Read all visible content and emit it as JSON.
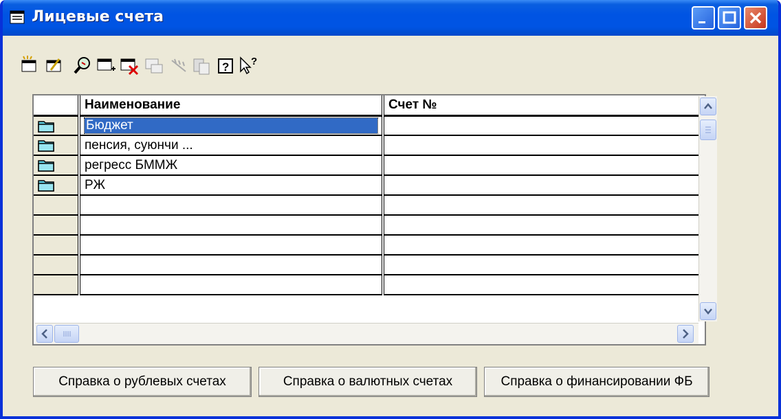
{
  "window": {
    "title": "Лицевые счета"
  },
  "toolbar": {
    "buttons": [
      {
        "icon": "new-record-icon"
      },
      {
        "icon": "edit-record-icon"
      },
      {
        "icon": "search-icon"
      },
      {
        "icon": "add-row-icon"
      },
      {
        "icon": "delete-row-icon"
      },
      {
        "icon": "copy-disabled-icon"
      },
      {
        "icon": "filter-disabled-icon"
      },
      {
        "icon": "paste-disabled-icon"
      },
      {
        "icon": "help-icon"
      },
      {
        "icon": "context-help-icon"
      }
    ]
  },
  "grid": {
    "columns": [
      "Наименование",
      "Счет №"
    ],
    "rows": [
      {
        "name": "Бюджет",
        "account": ""
      },
      {
        "name": "пенсия, суюнчи ...",
        "account": ""
      },
      {
        "name": "регресс БММЖ",
        "account": ""
      },
      {
        "name": "РЖ",
        "account": ""
      },
      {
        "name": "",
        "account": ""
      },
      {
        "name": "",
        "account": ""
      },
      {
        "name": "",
        "account": ""
      },
      {
        "name": "",
        "account": ""
      },
      {
        "name": "",
        "account": ""
      }
    ],
    "selected_row": 0
  },
  "footer": {
    "btn1": "Справка о рублевых счетах",
    "btn2": "Справка о валютных счетах",
    "btn3": "Справка о финансировании ФБ"
  },
  "colors": {
    "title_blue": "#0054e3",
    "selection": "#316ac5",
    "window_bg": "#ece9d8"
  }
}
